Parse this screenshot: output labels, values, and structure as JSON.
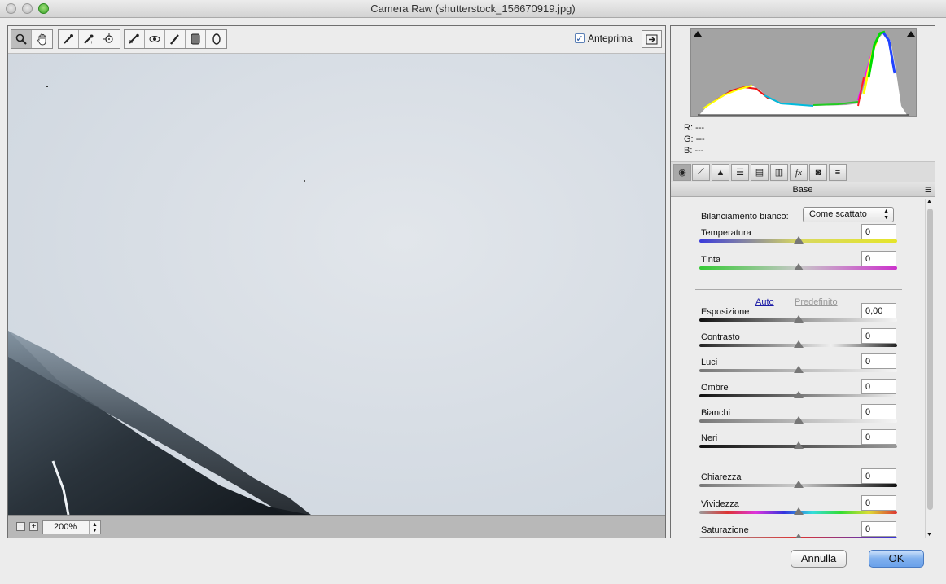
{
  "window": {
    "title": "Camera Raw (shutterstock_156670919.jpg)"
  },
  "toolbar": {
    "tools": [
      "zoom-icon",
      "hand-icon",
      "white-balance-icon",
      "color-sampler-icon",
      "target-adjust-icon",
      "crop-icon",
      "spot-removal-icon",
      "red-eye-icon",
      "adjustment-brush-icon",
      "graduated-filter-icon",
      "radial-filter-icon"
    ],
    "preview_label": "Anteprima",
    "preview_checked": true
  },
  "zoom": {
    "minus": "−",
    "plus": "+",
    "value": "200%"
  },
  "histogram": {
    "r_label": "R:",
    "g_label": "G:",
    "b_label": "B:",
    "r_value": "---",
    "g_value": "---",
    "b_value": "---"
  },
  "panel": {
    "title": "Base"
  },
  "white_balance": {
    "label": "Bilanciamento bianco:",
    "value": "Come scattato"
  },
  "auto_label": "Auto",
  "default_label": "Predefinito",
  "sliders": [
    {
      "name": "Temperatura",
      "value": "0",
      "level": 0.5
    },
    {
      "name": "Tinta",
      "value": "0",
      "level": 0.5
    },
    {
      "name": "Esposizione",
      "value": "0,00",
      "level": 0.5
    },
    {
      "name": "Contrasto",
      "value": "0",
      "level": 0.5
    },
    {
      "name": "Luci",
      "value": "0",
      "level": 0.5
    },
    {
      "name": "Ombre",
      "value": "0",
      "level": 0.5
    },
    {
      "name": "Bianchi",
      "value": "0",
      "level": 0.5
    },
    {
      "name": "Neri",
      "value": "0",
      "level": 0.5
    },
    {
      "name": "Chiarezza",
      "value": "0",
      "level": 0.5
    },
    {
      "name": "Vividezza",
      "value": "0",
      "level": 0.5
    },
    {
      "name": "Saturazione",
      "value": "0",
      "level": 0.5
    }
  ],
  "buttons": {
    "cancel": "Annulla",
    "ok": "OK"
  },
  "colors": {
    "accent": "#6aa1ea",
    "link": "#1a1aa6"
  }
}
